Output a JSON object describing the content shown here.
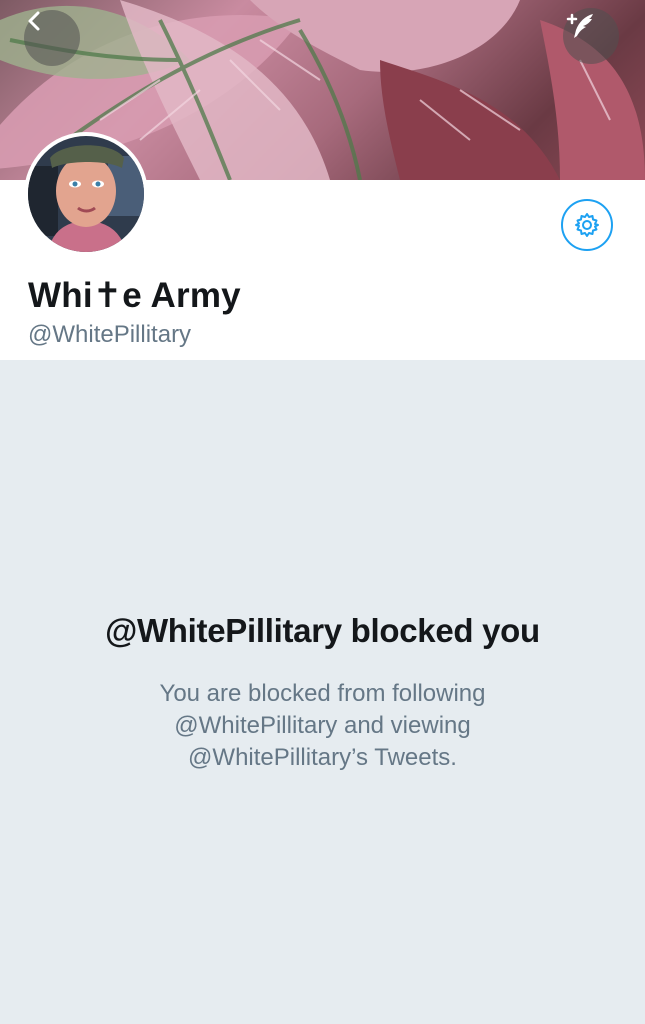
{
  "header": {
    "back_icon": "chevron-left-icon",
    "compose_icon": "compose-tweet-icon"
  },
  "profile": {
    "display_name": "Whi✝e Army",
    "handle": "@WhitePillitary",
    "settings_icon": "gear-icon"
  },
  "blocked": {
    "title": "@WhitePillitary blocked you",
    "message": "You are blocked from following @WhitePillitary and viewing @WhitePillitary’s Tweets."
  },
  "colors": {
    "accent": "#1da1f2",
    "background": "#e6ecf0",
    "text_primary": "#14171a",
    "text_secondary": "#657786"
  }
}
